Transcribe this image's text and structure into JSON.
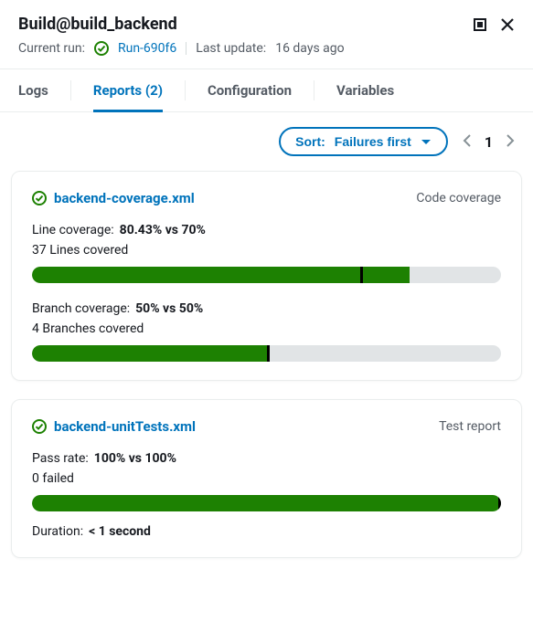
{
  "header": {
    "title": "Build@build_backend",
    "currentRunLabel": "Current run:",
    "currentRunLink": "Run-690f6",
    "lastUpdateLabel": "Last update:",
    "lastUpdateValue": "16 days ago"
  },
  "tabs": {
    "logs": "Logs",
    "reports": "Reports",
    "reportsCount": "(2)",
    "configuration": "Configuration",
    "variables": "Variables"
  },
  "controls": {
    "sortPrefix": "Sort:",
    "sortValue": "Failures first",
    "page": "1"
  },
  "cards": [
    {
      "file": "backend-coverage.xml",
      "type": "Code coverage",
      "lineLabel": "Line coverage:",
      "lineValue": "80.43% vs 70%",
      "lineSub": "37 Lines covered",
      "lineFillPct": 80.43,
      "lineMarkPct": 70,
      "branchLabel": "Branch coverage:",
      "branchValue": "50% vs 50%",
      "branchSub": "4 Branches covered",
      "branchFillPct": 50,
      "branchMarkPct": 50
    },
    {
      "file": "backend-unitTests.xml",
      "type": "Test report",
      "passLabel": "Pass rate:",
      "passValue": "100% vs 100%",
      "passSub": "0 failed",
      "passFillPct": 100,
      "passMarkPct": 100,
      "durationLabel": "Duration:",
      "durationValue": "< 1 second"
    }
  ]
}
